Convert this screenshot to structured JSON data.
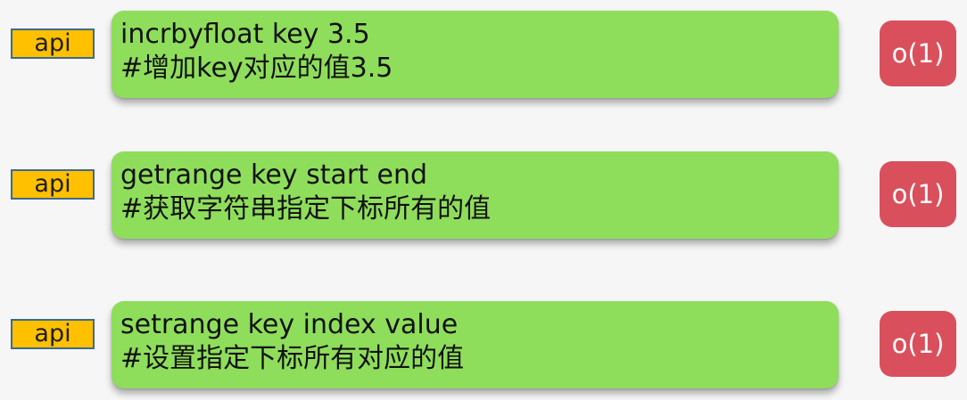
{
  "rows": [
    {
      "tag": "api",
      "command": "incrbyfloat key 3.5",
      "comment": "#增加key对应的值3.5",
      "complexity": "o(1)"
    },
    {
      "tag": "api",
      "command": "getrange key start end",
      "comment": "#获取字符串指定下标所有的值",
      "complexity": "o(1)"
    },
    {
      "tag": "api",
      "command": "setrange key index value",
      "comment": "#设置指定下标所有对应的值",
      "complexity": "o(1)"
    }
  ],
  "colors": {
    "api_tag_bg": "#ffc000",
    "api_tag_border": "#3d6a8c",
    "command_box_bg": "#8fde5b",
    "complexity_bg": "#d9505c",
    "background": "#f6f6f6"
  }
}
